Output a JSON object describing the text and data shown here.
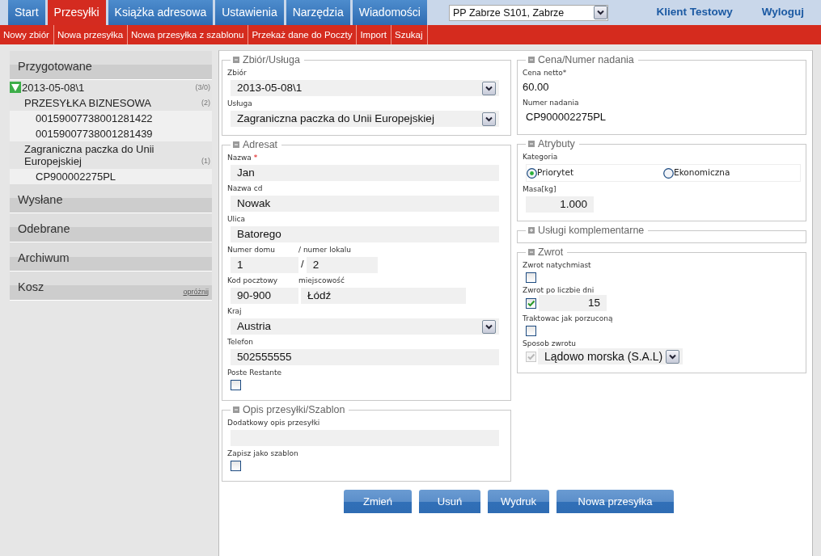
{
  "nav_tabs": [
    {
      "label": "Start",
      "selected": false
    },
    {
      "label": "Przesyłki",
      "selected": true
    },
    {
      "label": "Książka adresowa",
      "selected": false
    },
    {
      "label": "Ustawienia",
      "selected": false
    },
    {
      "label": "Narzędzia",
      "selected": false
    },
    {
      "label": "Wiadomości",
      "selected": false
    }
  ],
  "office_select": {
    "value": "PP Zabrze S101, Zabrze"
  },
  "user_name": "Klient Testowy",
  "logout": "Wyloguj",
  "subnav": [
    "Nowy zbiór",
    "Nowa przesyłka",
    "Nowa przesyłka z szablonu",
    "Przekaż dane do Poczty",
    "Import",
    "Szukaj"
  ],
  "sidebar": [
    {
      "title": "Przygotowane",
      "tree": [
        {
          "label": "2013-05-08\\1",
          "count": "(3/0)",
          "expanded": true,
          "children": [
            {
              "label": "PRZESYŁKA BIZNESOWA",
              "count": "(2)",
              "children": [
                {
                  "label": "00159007738001281422"
                },
                {
                  "label": "00159007738001281439"
                }
              ]
            },
            {
              "label": "Zagraniczna paczka do Unii Europejskiej",
              "count": "(1)",
              "children": [
                {
                  "label": "CP900002275PL"
                }
              ]
            }
          ]
        }
      ]
    },
    {
      "title": "Wysłane"
    },
    {
      "title": "Odebrane"
    },
    {
      "title": "Archiwum"
    },
    {
      "title": "Kosz",
      "action": "opróżnij"
    }
  ],
  "form_left": [
    {
      "title": "Zbiór/Usługa",
      "expanded": true,
      "fields": [
        {
          "kind": "select",
          "label": "Zbiór",
          "value": "2013-05-08\\1"
        },
        {
          "kind": "select",
          "label": "Usługa",
          "value": "Zagraniczna paczka do Unii Europejskiej"
        }
      ]
    },
    {
      "title": "Adresat",
      "expanded": true,
      "fields": [
        {
          "kind": "text",
          "label": "Nazwa",
          "required_mark": "*",
          "value": "Jan"
        },
        {
          "kind": "text",
          "label": "Nazwa cd",
          "value": "Nowak"
        },
        {
          "kind": "text",
          "label": "Ulica",
          "value": "Batorego"
        },
        {
          "kind": "pair",
          "items": [
            {
              "label": "Numer domu",
              "value": "1"
            },
            {
              "label": "/ numer lokalu",
              "prefix": "/",
              "value": "2"
            }
          ]
        },
        {
          "kind": "pair",
          "items": [
            {
              "label": "Kod pocztowy",
              "value": "90-900"
            },
            {
              "label": "miejscowość",
              "value": "Łódź"
            }
          ]
        },
        {
          "kind": "select",
          "label": "Kraj",
          "value": "Austria"
        },
        {
          "kind": "text",
          "label": "Telefon",
          "value": "502555555"
        },
        {
          "kind": "checkbox",
          "label": "Poste Restante",
          "checked": false
        }
      ]
    },
    {
      "title": "Opis przesyłki/Szablon",
      "expanded": true,
      "fields": [
        {
          "kind": "text",
          "label": "Dodatkowy opis przesyłki"
        },
        {
          "kind": "checkbox",
          "label": "Zapisz jako szablon",
          "checked": false
        }
      ]
    }
  ],
  "form_right": [
    {
      "title": "Cena/Numer nadania",
      "expanded": true,
      "fields": [
        {
          "kind": "static",
          "label": "Cena netto*",
          "value": "60.00"
        },
        {
          "kind": "static",
          "label": "Numer nadania",
          "value": "CP900002275PL"
        }
      ]
    },
    {
      "title": "Atrybuty",
      "expanded": true,
      "fields": [
        {
          "kind": "radio",
          "label": "Kategoria",
          "options": [
            {
              "label": "Priorytet",
              "selected": true
            },
            {
              "label": "Ekonomiczna",
              "selected": false
            }
          ]
        },
        {
          "kind": "number",
          "label": "Masa[kg]",
          "value": "1.000"
        }
      ]
    },
    {
      "title": "Usługi komplementarne",
      "expanded": false
    },
    {
      "title": "Zwrot",
      "expanded": true,
      "fields": [
        {
          "kind": "checkbox",
          "label": "Zwrot natychmiast",
          "checked": false
        },
        {
          "kind": "checkbox-number",
          "label": "Zwrot po liczbie dni",
          "checked": true,
          "value": "15"
        },
        {
          "kind": "checkbox",
          "label": "Traktowac jak porzuconą",
          "checked": false
        },
        {
          "kind": "checkbox-select",
          "label": "Sposob zwrotu",
          "checked": true,
          "disabled": true,
          "value": "Lądowo morska (S.A.L)"
        }
      ]
    }
  ],
  "buttons": [
    "Zmień",
    "Usuń",
    "Wydruk",
    "Nowa przesyłka"
  ]
}
